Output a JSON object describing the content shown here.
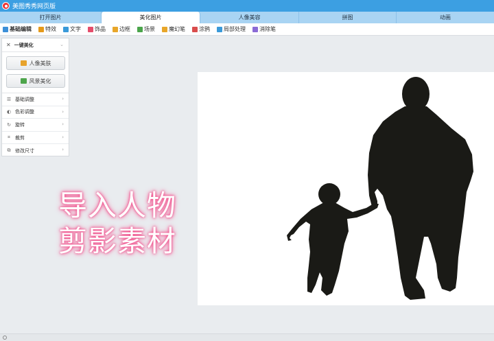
{
  "window": {
    "title": "美图秀秀网页版"
  },
  "tabs": [
    {
      "label": "打开图片",
      "active": false
    },
    {
      "label": "美化图片",
      "active": true
    },
    {
      "label": "人像美容",
      "active": false
    },
    {
      "label": "拼图",
      "active": false
    },
    {
      "label": "动画",
      "active": false
    }
  ],
  "toolbar": [
    {
      "label": "基础编辑",
      "icon": "basic-edit-icon",
      "color": "#3c8fd8"
    },
    {
      "label": "特效",
      "icon": "brush-icon",
      "color": "#e59a1a"
    },
    {
      "label": "文字",
      "icon": "text-icon",
      "color": "#3a9ad9"
    },
    {
      "label": "饰品",
      "icon": "accessory-icon",
      "color": "#e54d6b"
    },
    {
      "label": "边框",
      "icon": "frame-icon",
      "color": "#e8a62a"
    },
    {
      "label": "场景",
      "icon": "scene-icon",
      "color": "#4ba54b"
    },
    {
      "label": "魔幻笔",
      "icon": "magic-pen-icon",
      "color": "#e8a62a"
    },
    {
      "label": "涂鸦",
      "icon": "doodle-icon",
      "color": "#d94d4d"
    },
    {
      "label": "局部处理",
      "icon": "local-process-icon",
      "color": "#3a9ad9"
    },
    {
      "label": "消除笔",
      "icon": "eraser-icon",
      "color": "#8b6bd6"
    }
  ],
  "panel": {
    "header": "一键美化",
    "buttons": [
      {
        "label": "人像美肤",
        "icon": "portrait-icon",
        "color": "#e7a32c"
      },
      {
        "label": "风景美化",
        "icon": "landscape-icon",
        "color": "#4da54b"
      }
    ],
    "rows": [
      {
        "label": "基础调整",
        "icon": "adjust-icon",
        "glyph": "☰"
      },
      {
        "label": "色彩调整",
        "icon": "color-icon",
        "glyph": "◐"
      },
      {
        "label": "旋转",
        "icon": "rotate-icon",
        "glyph": "↻"
      },
      {
        "label": "裁剪",
        "icon": "crop-icon",
        "glyph": "⌗"
      },
      {
        "label": "修改尺寸",
        "icon": "resize-icon",
        "glyph": "⧉"
      }
    ]
  },
  "overlay": {
    "line1": "导入人物",
    "line2": "剪影素材"
  },
  "colors": {
    "titlebar": "#3c9fe2",
    "tabbar": "#a9d4f3",
    "silhouette": "#1a1a16",
    "overlay_glow": "#f24c8a"
  }
}
